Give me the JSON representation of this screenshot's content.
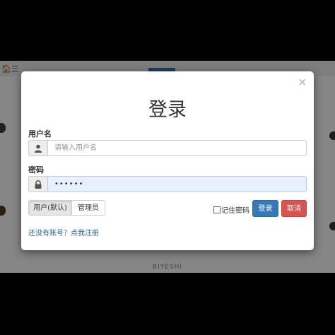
{
  "background": {
    "nav_home_text": "🏠三",
    "footer_text": "BIYESHI"
  },
  "modal": {
    "close_symbol": "×",
    "title": "登录",
    "username": {
      "label": "用户名",
      "placeholder": "请输入用户名",
      "value": "",
      "icon": "user-icon"
    },
    "password": {
      "label": "密码",
      "value_masked": "••••••",
      "icon": "lock-icon"
    },
    "roles": {
      "options": [
        "用户(默认)",
        "管理员"
      ],
      "selected": "用户(默认)"
    },
    "remember_label": "记住密码",
    "remember_checked": false,
    "login_button": "登录",
    "cancel_button": "取消",
    "register_link": "还没有账号？点我注册"
  },
  "colors": {
    "login_button": "#337ab7",
    "cancel_button": "#d9534f",
    "link": "#2a6496",
    "autofill_bg": "#e8f0fe"
  }
}
